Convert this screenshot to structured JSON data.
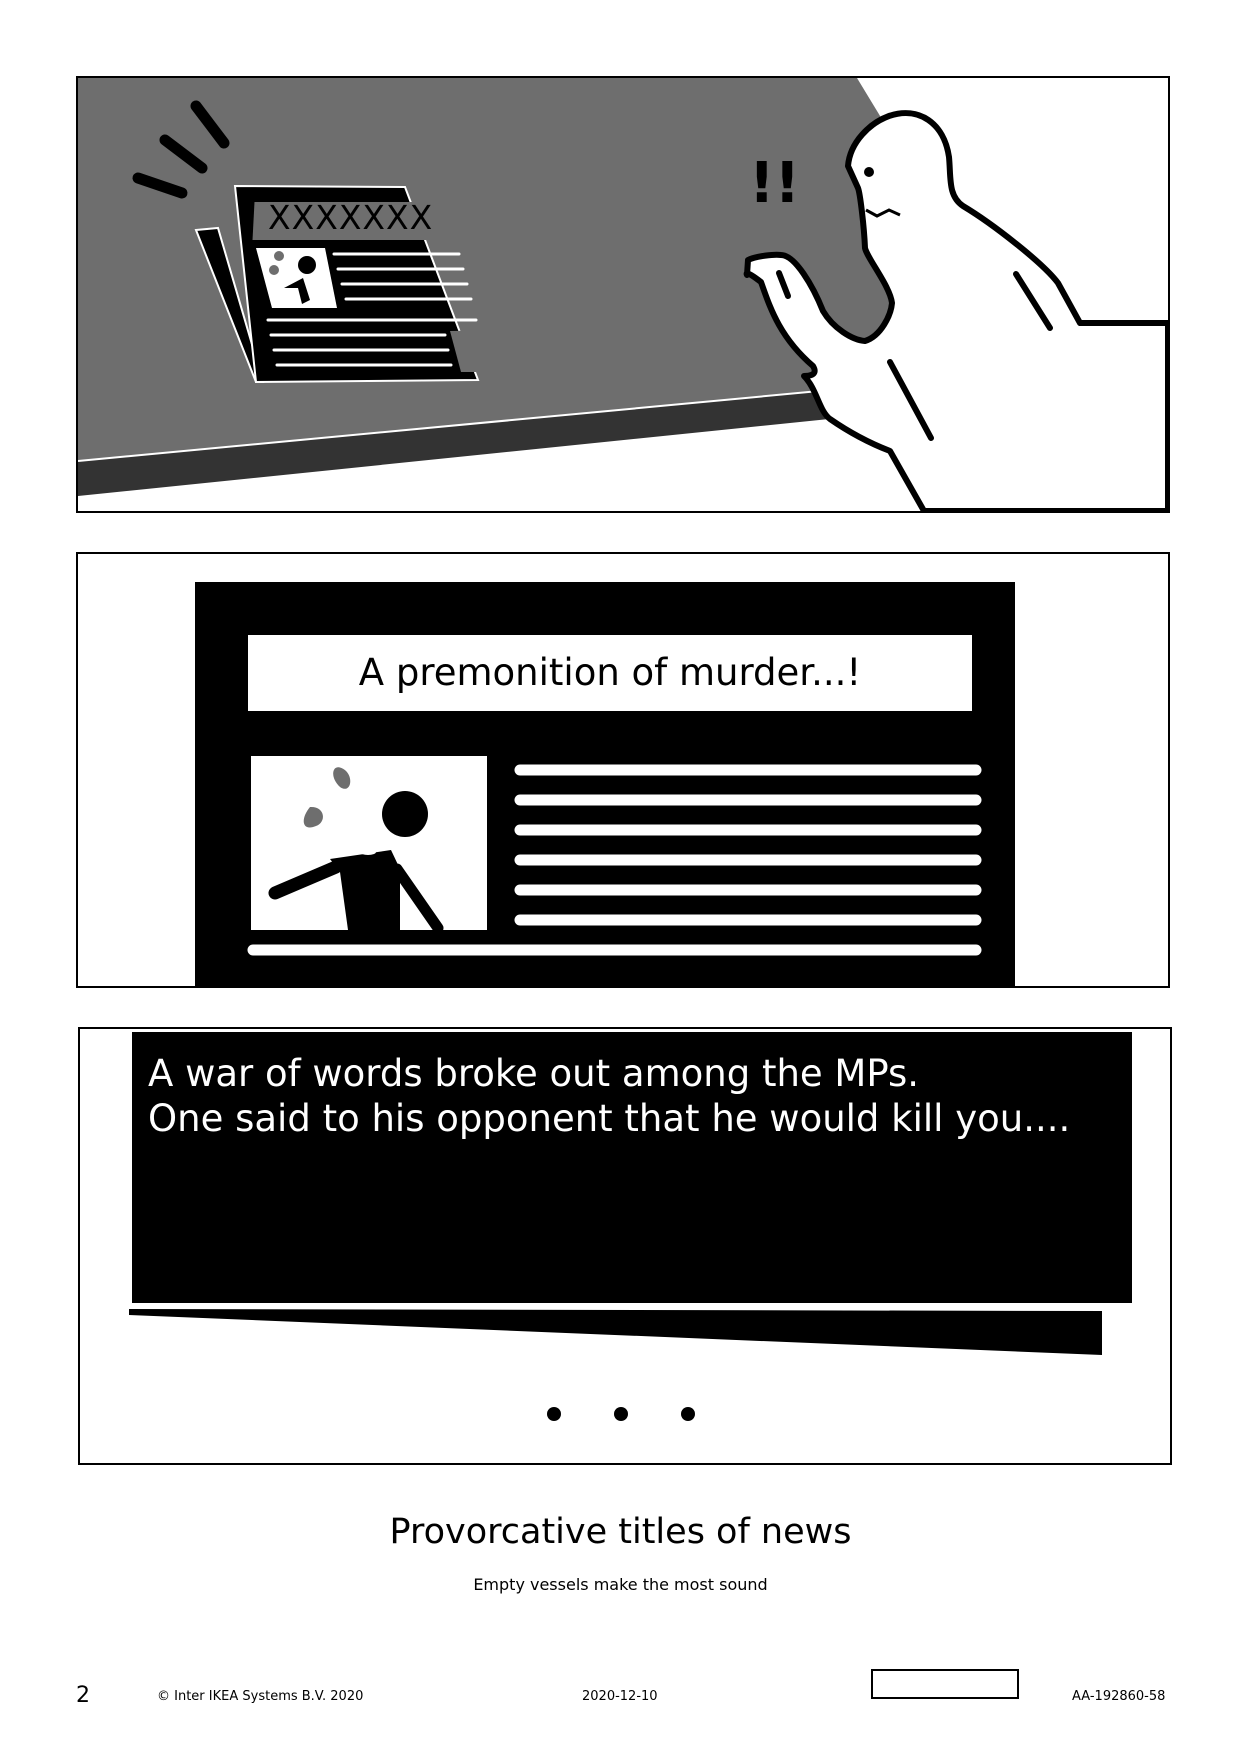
{
  "panel1": {
    "newspaper_headline": "XXXXXXX",
    "exclamation": "!!"
  },
  "panel2": {
    "headline": "A premonition of murder...!"
  },
  "panel3": {
    "lines": [
      "A war of words broke out among the MPs.",
      "One said to his opponent that he would kill you...."
    ]
  },
  "caption": {
    "title": "Provorcative titles of news",
    "subtitle": "Empty vessels make the most sound"
  },
  "footer": {
    "page_number": "2",
    "copyright": "© Inter IKEA Systems B.V. 2020",
    "date": "2020-12-10",
    "doc_code": "AA-192860-58"
  },
  "colors": {
    "table_top": "#6e6e6e",
    "table_edge": "#333333",
    "splash": "#6e6e6e",
    "ink": "#000000",
    "paper": "#ffffff"
  },
  "icons": {
    "panel1_figure": "surprised-person-icon",
    "panel1_paper": "newspaper-icon",
    "panel2_photo": "injured-person-icon",
    "panel3_dots": "ellipsis-icon"
  }
}
